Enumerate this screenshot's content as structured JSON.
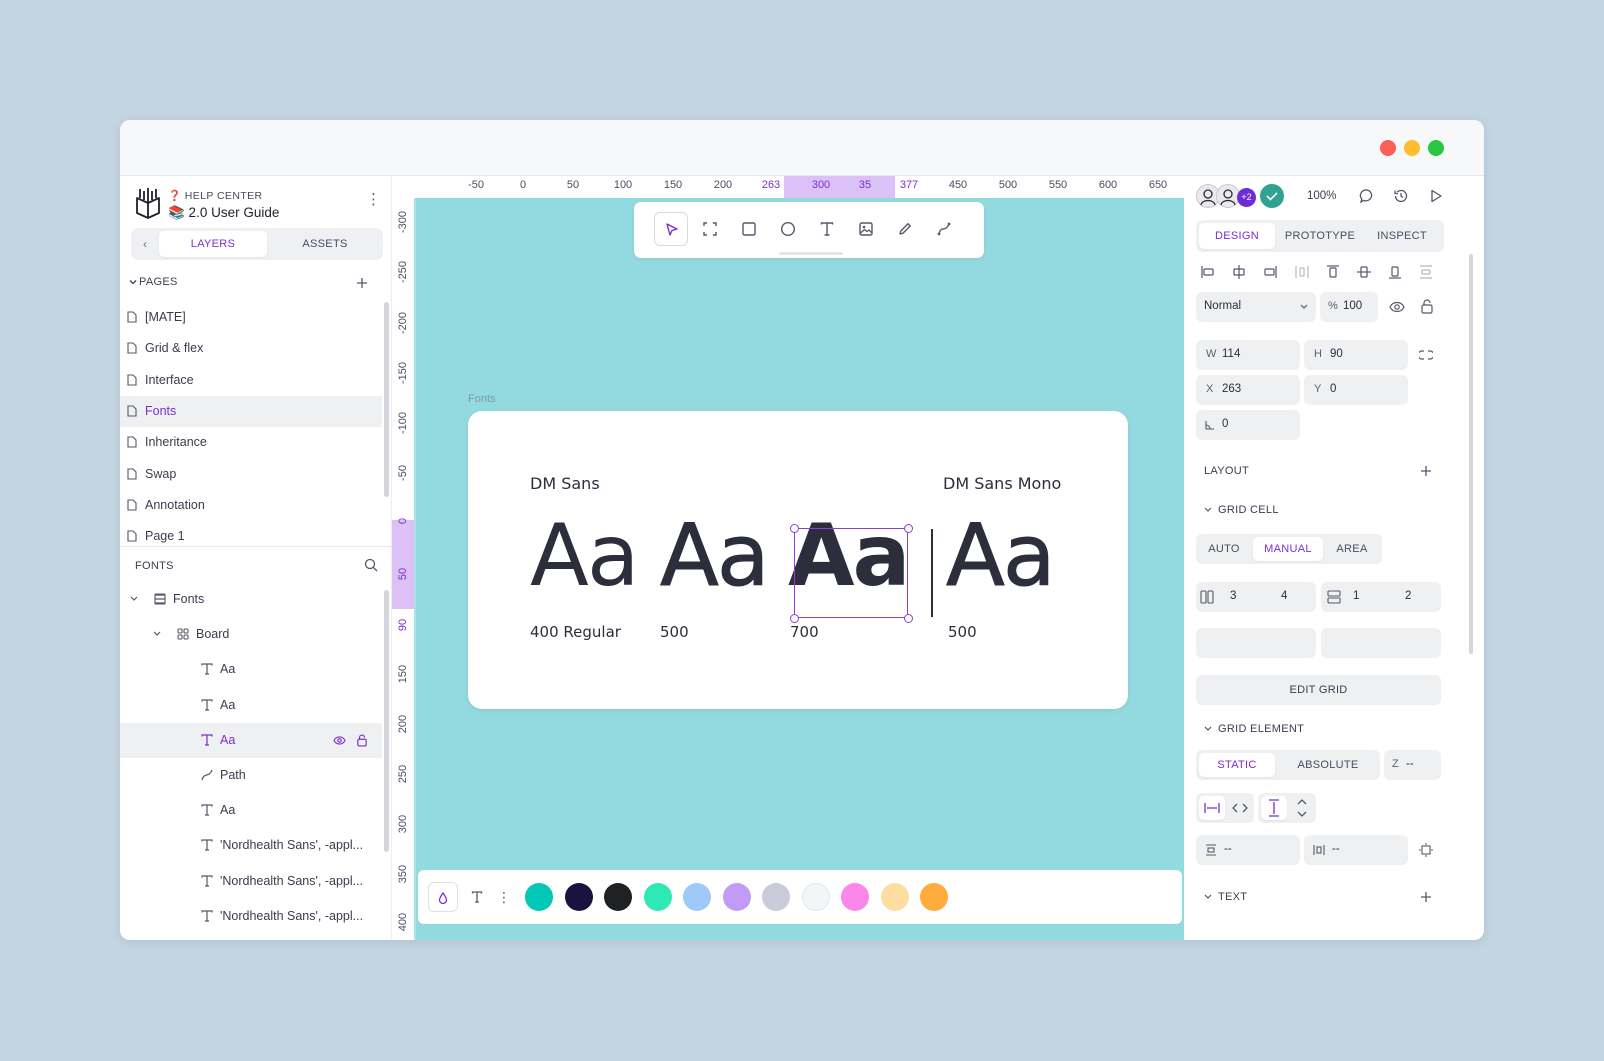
{
  "project": {
    "help_center": "❓ HELP CENTER",
    "guide": "📚 2.0 User Guide"
  },
  "left_tabs": {
    "layers": "LAYERS",
    "assets": "ASSETS"
  },
  "pages": {
    "header": "PAGES",
    "items": [
      "[MATE]",
      "Grid & flex",
      "Interface",
      "Fonts",
      "Inheritance",
      "Swap",
      "Annotation",
      "Page 1"
    ],
    "selected": "Fonts"
  },
  "layers": {
    "header": "FONTS",
    "items": [
      {
        "label": "Fonts",
        "icon": "board-icon"
      },
      {
        "label": "Board",
        "icon": "component-icon"
      },
      {
        "label": "Aa",
        "icon": "text-icon"
      },
      {
        "label": "Aa",
        "icon": "text-icon"
      },
      {
        "label": "Aa",
        "icon": "text-icon"
      },
      {
        "label": "Path",
        "icon": "path-icon"
      },
      {
        "label": "Aa",
        "icon": "text-icon"
      },
      {
        "label": "'Nordhealth Sans', -appl...",
        "icon": "text-icon"
      },
      {
        "label": "'Nordhealth Sans', -appl...",
        "icon": "text-icon"
      },
      {
        "label": "'Nordhealth Sans', -appl...",
        "icon": "text-icon"
      }
    ]
  },
  "hruler": [
    "-50",
    "0",
    "50",
    "100",
    "150",
    "200",
    "263",
    "300",
    "35",
    "377",
    "450",
    "500",
    "550",
    "600",
    "650"
  ],
  "vruler": [
    "-300",
    "-250",
    "-200",
    "-150",
    "-100",
    "-50",
    "0",
    "50",
    "90",
    "150",
    "200",
    "250",
    "300",
    "350",
    "400"
  ],
  "canvas": {
    "frame_label": "Fonts",
    "font_left": "DM Sans",
    "font_right": "DM Sans Mono",
    "samples": [
      "Aa",
      "Aa",
      "Aa",
      "Aa"
    ],
    "weights": [
      "400 Regular",
      "500",
      "700",
      "500"
    ]
  },
  "palette": {
    "colors": [
      "#00c8b4",
      "#1a1340",
      "#1f2125",
      "#2ee8b6",
      "#9ec9f8",
      "#c29bf7",
      "#cacbd8",
      "#f3f6f9",
      "#fc87ea",
      "#fddea0",
      "#ffab3d"
    ]
  },
  "right": {
    "zoom": "100%",
    "tabs": {
      "design": "DESIGN",
      "prototype": "PROTOTYPE",
      "inspect": "INSPECT"
    },
    "blend": "Normal",
    "opacity_label": "%",
    "opacity": "100",
    "w_label": "W",
    "w": "114",
    "h_label": "H",
    "h": "90",
    "x_label": "X",
    "x": "263",
    "y_label": "Y",
    "y": "0",
    "rotation": "0",
    "layout": "LAYOUT",
    "grid_cell": "GRID CELL",
    "cell_modes": [
      "AUTO",
      "MANUAL",
      "AREA"
    ],
    "col_start": "3",
    "col_end": "4",
    "row_start": "1",
    "row_end": "2",
    "edit_grid": "EDIT GRID",
    "grid_element": "GRID ELEMENT",
    "positions": [
      "STATIC",
      "ABSOLUTE"
    ],
    "z_label": "Z",
    "z": "--",
    "margin_v": "--",
    "margin_h": "--",
    "text": "TEXT",
    "avatar_more": "+2"
  },
  "colors": {
    "accent": "#7b2fd0",
    "canvas": "#93dae0",
    "bg": "#c3d5e1"
  }
}
